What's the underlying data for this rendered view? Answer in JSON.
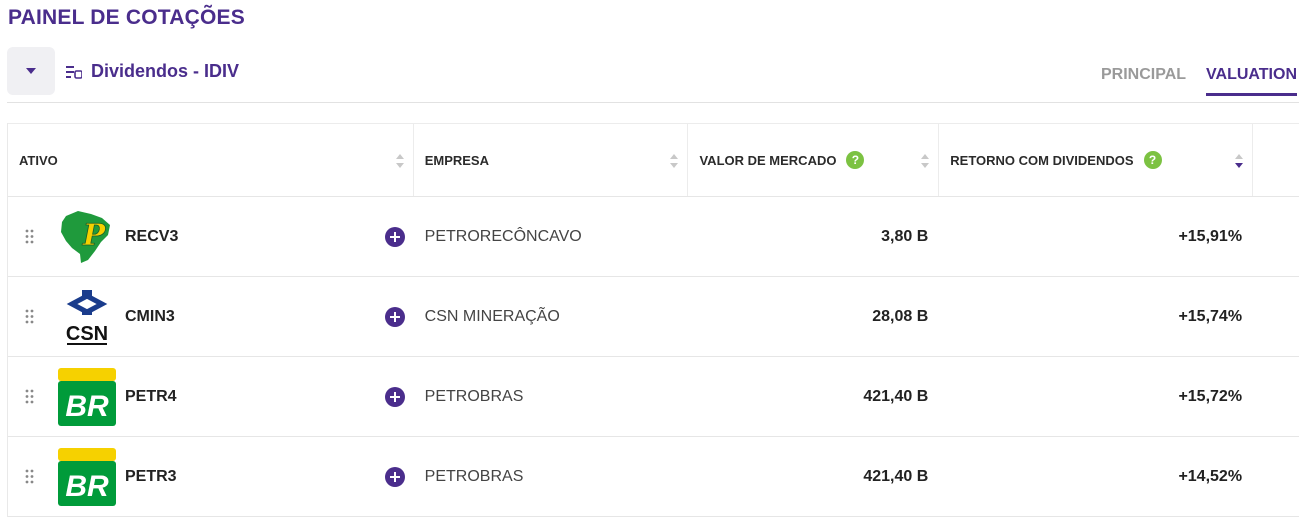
{
  "header": {
    "title": "PAINEL DE COTAÇÕES",
    "list_name": "Dividendos - IDIV",
    "tabs": [
      {
        "label": "PRINCIPAL",
        "active": false
      },
      {
        "label": "VALUATION",
        "active": true
      }
    ]
  },
  "icons": {
    "dropdown": "caret-down-icon",
    "list": "list-icon",
    "sort": "sort-icon",
    "help": "question-icon",
    "drag": "drag-handle-icon",
    "add": "plus-circle-icon"
  },
  "colors": {
    "brand": "#4a2d8c",
    "help_badge": "#7cc242",
    "petrobras_green": "#009b3a",
    "petrobras_yellow": "#f6d100",
    "csn_blue": "#1a3c8c"
  },
  "table": {
    "columns": [
      {
        "label": "ATIVO",
        "help": false,
        "sort": "none"
      },
      {
        "label": "EMPRESA",
        "help": false,
        "sort": "none"
      },
      {
        "label": "VALOR DE MERCADO",
        "help": true,
        "help_text": "?",
        "sort": "none"
      },
      {
        "label": "RETORNO COM DIVIDENDOS",
        "help": true,
        "help_text": "?",
        "sort": "descending"
      }
    ],
    "rows": [
      {
        "ticker": "RECV3",
        "logo": "petroreconcavo-logo",
        "company": "PETRORECÔNCAVO",
        "market_value": "3,80 B",
        "dividend_return": "+15,91%"
      },
      {
        "ticker": "CMIN3",
        "logo": "csn-logo",
        "company": "CSN MINERAÇÃO",
        "market_value": "28,08 B",
        "dividend_return": "+15,74%"
      },
      {
        "ticker": "PETR4",
        "logo": "petrobras-logo",
        "company": "PETROBRAS",
        "market_value": "421,40 B",
        "dividend_return": "+15,72%"
      },
      {
        "ticker": "PETR3",
        "logo": "petrobras-logo",
        "company": "PETROBRAS",
        "market_value": "421,40 B",
        "dividend_return": "+14,52%"
      }
    ],
    "logo_text": {
      "recv": "P",
      "csn": "CSN",
      "petrobras": "BR"
    }
  }
}
